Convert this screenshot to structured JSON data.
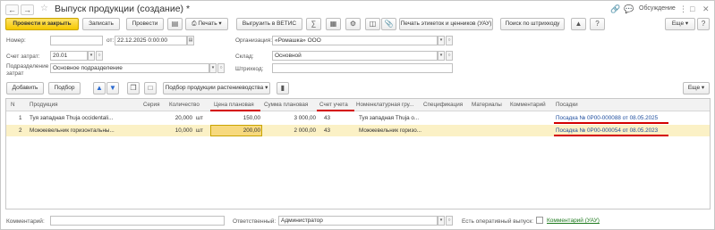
{
  "window": {
    "title": "Выпуск продукции (создание) *",
    "discuss_label": "Обсуждение"
  },
  "toolbar": {
    "post_close": "Провести и закрыть",
    "save": "Записать",
    "post": "Провести",
    "print": "Печать",
    "upload_vetis": "Выгрузить в ВЕТИС",
    "print_labels": "Печать этикеток и ценников (УАУ)",
    "barcode_search": "Поиск по штрихкоду",
    "more": "Еще"
  },
  "form": {
    "number_label": "Номер:",
    "number_value": "",
    "date_label": "от:",
    "date_value": "22.12.2025  0:00:00",
    "org_label": "Организация:",
    "org_value": "«Ромашка» ООО",
    "cost_account_label": "Счет затрат:",
    "cost_account_value": "20.01",
    "warehouse_label": "Склад:",
    "warehouse_value": "Основной",
    "division_label": "Подразделение затрат",
    "division_value": "Основное подразделение",
    "barcode_label": "Штрихкод:",
    "barcode_value": ""
  },
  "table_toolbar": {
    "add": "Добавить",
    "pick": "Подбор",
    "plant_pick": "Подбор продукции растениеводства",
    "more": "Еще"
  },
  "table": {
    "columns": [
      "N",
      "Продукция",
      "Серия",
      "Количество",
      "Цена плановая",
      "Сумма плановая",
      "Счет учета",
      "Номенклатурная гру...",
      "Спецификация",
      "Материалы",
      "Комментарий",
      "Посадки"
    ],
    "rows": [
      {
        "n": "1",
        "product": "Туя западная Thuja occidentali...",
        "series": "",
        "qty": "20,000",
        "unit": "шт",
        "price": "150,00",
        "sum": "3 000,00",
        "account": "43",
        "group": "Туя западная Thuja o...",
        "spec": "",
        "materials": "",
        "comment": "",
        "planting": "Посадка № 0Р00-000088 от 08.05.2025"
      },
      {
        "n": "2",
        "product": "Можжевельник горизонтальны...",
        "series": "",
        "qty": "10,000",
        "unit": "шт",
        "price": "200,00",
        "sum": "2 000,00",
        "account": "43",
        "group": "Можжевельник горизо...",
        "spec": "",
        "materials": "",
        "comment": "",
        "planting": "Посадка № 0Р00-000054 от 08.05.2023"
      }
    ]
  },
  "footer": {
    "comment_label": "Комментарий:",
    "comment_value": "",
    "responsible_label": "Ответственный:",
    "responsible_value": "Администратор",
    "operative_label": "Есть оперативный выпуск:",
    "comment_link": "Комментарий (УАУ)"
  },
  "colors": {
    "primary_button": "#f5c800",
    "selected_row": "#fbf1c6",
    "highlight_underline": "#d40000",
    "link": "#1f4e9e"
  }
}
